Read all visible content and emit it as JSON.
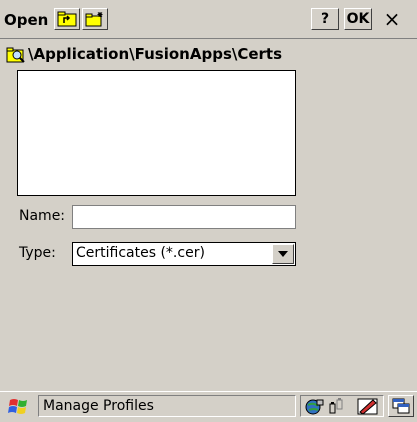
{
  "window": {
    "title": "Open",
    "help_label": "?",
    "ok_label": "OK",
    "close_label": "×"
  },
  "path": {
    "current": "\\Application\\FusionApps\\Certs"
  },
  "file_list": [],
  "form": {
    "name_label": "Name:",
    "name_value": "",
    "type_label": "Type:",
    "type_selected": "Certificates (*.cer)"
  },
  "taskbar": {
    "task_label": "Manage Profiles"
  },
  "icons": {
    "start": "windows-flag-icon",
    "up_folder": "up-folder-icon",
    "new_folder": "new-folder-icon",
    "folder_search": "folder-search-icon",
    "network": "network-icon",
    "battery": "battery-icon",
    "input_panel": "pen-input-icon",
    "desktop": "desktop-icon"
  }
}
